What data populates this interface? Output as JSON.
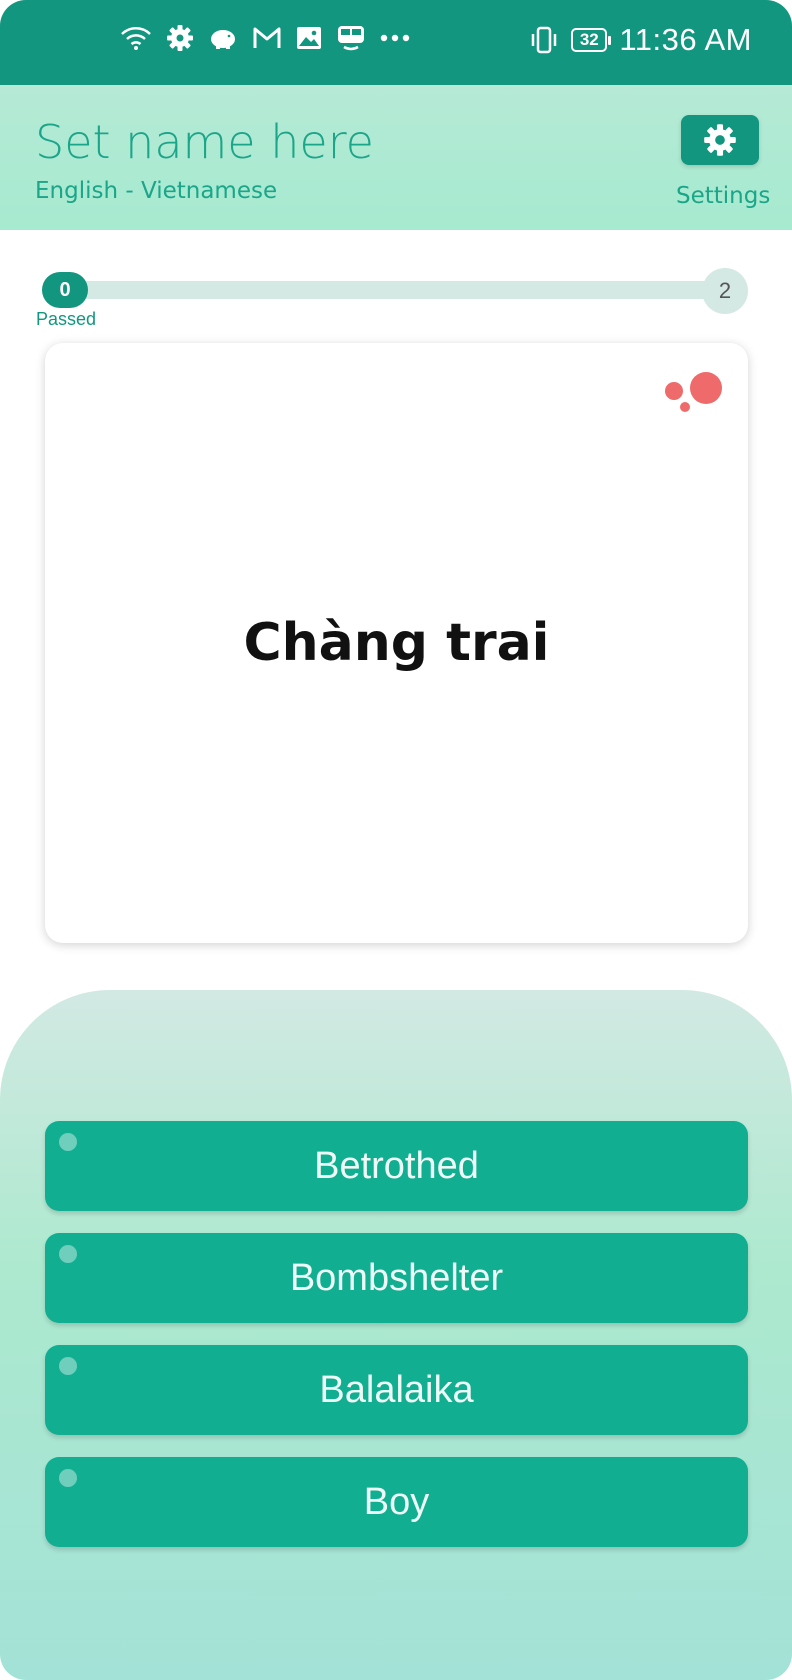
{
  "status_bar": {
    "time": "11:36 AM",
    "battery": "32",
    "icons": [
      "wifi-icon",
      "settings-icon",
      "piggy-bank-icon",
      "gmail-icon",
      "gallery-icon",
      "bus-icon",
      "more-dots-icon",
      "vibrate-icon"
    ]
  },
  "header": {
    "set_title": "Set name here",
    "language_pair": "English - Vietnamese",
    "settings_label": "Settings"
  },
  "progress": {
    "passed": "0",
    "total": "2",
    "passed_label": "Passed"
  },
  "card": {
    "word": "Chàng trai"
  },
  "answers": [
    {
      "label": "Betrothed"
    },
    {
      "label": "Bombshelter"
    },
    {
      "label": "Balalaika"
    },
    {
      "label": "Boy"
    }
  ],
  "colors": {
    "primary": "#13967f",
    "answer_bg": "#12ae92",
    "accent_dots": "#ef6b6b"
  }
}
